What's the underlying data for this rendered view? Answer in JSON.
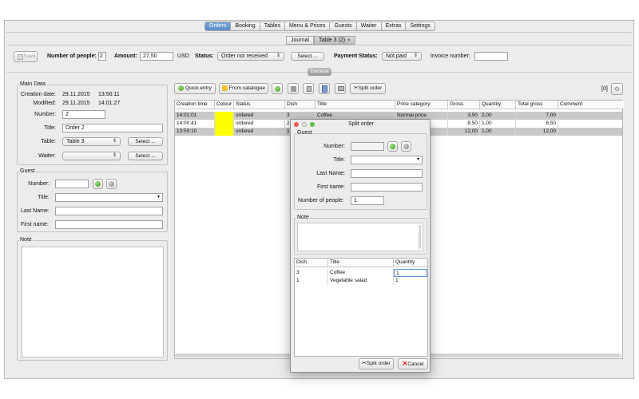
{
  "tabs": [
    "Orders",
    "Booking",
    "Tables",
    "Menu & Prices",
    "Guests",
    "Waiter",
    "Extras",
    "Settings"
  ],
  "subtabs": {
    "journal": "Journal",
    "table": "Table 3 (2)",
    "close": "×"
  },
  "toolbar": {
    "save": "Save",
    "people_label": "Number of people:",
    "people_value": "2",
    "amount_label": "Amount:",
    "amount_value": "27,50",
    "currency": "USD",
    "status_label": "Status:",
    "status_value": "Order not received",
    "select_btn": "Select ...",
    "payment_label": "Payment Status:",
    "payment_value": "Not paid",
    "invoice_label": "Invoice number:",
    "invoice_value": ""
  },
  "general_label": "General",
  "main_data": {
    "title": "Main Data",
    "creation_label": "Creation date:",
    "creation_date": "29.11.2015",
    "creation_time": "13:56:11",
    "modified_label": "Modified:",
    "modified_date": "29.11.2015",
    "modified_time": "14:01:27",
    "number_label": "Number:",
    "number_value": "2",
    "title_label": "Title:",
    "title_value": "Order 2",
    "table_label": "Table:",
    "table_value": "Table 3",
    "waiter_label": "Waiter:",
    "waiter_value": "",
    "select_btn": "Select ..."
  },
  "guest": {
    "title": "Guest",
    "number_label": "Number:",
    "title_label": "Title:",
    "lastname_label": "Last Name:",
    "firstname_label": "First name:"
  },
  "note": {
    "title": "Note"
  },
  "order_toolbar": {
    "quick_entry": "Quick entry",
    "from_catalogue": "From catalogue",
    "split_order": "Split order",
    "count": "[0]"
  },
  "order_table": {
    "headers": [
      "Creation time",
      "Colour",
      "Status",
      "Dish",
      "Title",
      "Price category",
      "Gross",
      "Quantity",
      "Total gross",
      "Comment"
    ],
    "rows": [
      [
        "14:01:01",
        "",
        "ordered",
        "3",
        "Coffee",
        "Normal price",
        "3,50",
        "2,00",
        "7,00",
        ""
      ],
      [
        "14:00:41",
        "",
        "ordered",
        "2",
        "",
        "",
        "8,50",
        "1,00",
        "8,50",
        ""
      ],
      [
        "13:59:10",
        "",
        "ordered",
        "1",
        "",
        "",
        "12,00",
        "1,00",
        "12,00",
        ""
      ]
    ],
    "colour_value": "#ffff00"
  },
  "dialog": {
    "title": "Split order",
    "guest_title": "Guest",
    "number_label": "Number:",
    "title_label": "Title:",
    "lastname_label": "Last Name:",
    "firstname_label": "First name:",
    "people_label": "Number of people:",
    "people_value": "1",
    "note_title": "Note",
    "headers": [
      "Dish",
      "Title",
      "Quantity"
    ],
    "rows": [
      [
        "3",
        "Coffee",
        "1"
      ],
      [
        "1",
        "Vegetable salad",
        "1"
      ]
    ],
    "split_btn": "Split order",
    "cancel_btn": "Cancel"
  }
}
